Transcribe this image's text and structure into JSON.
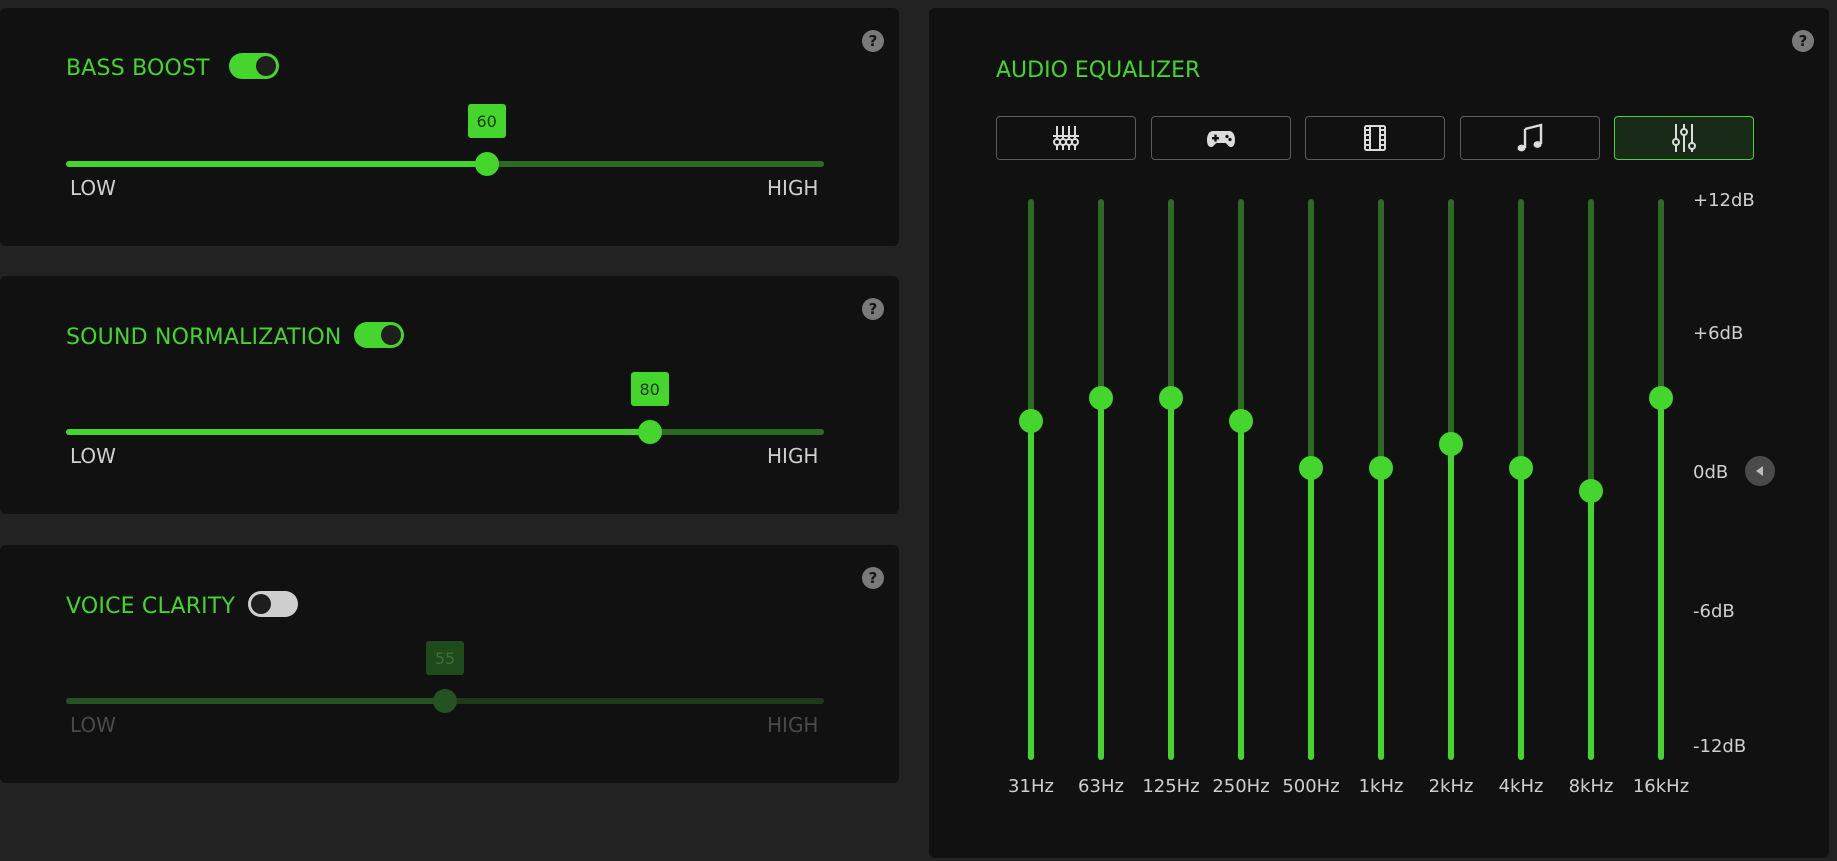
{
  "help_glyph": "?",
  "bass_boost": {
    "title": "BASS BOOST",
    "enabled": true,
    "value": 60,
    "value_label": "60",
    "fraction": 0.555,
    "low": "LOW",
    "high": "HIGH"
  },
  "sound_normalization": {
    "title": "SOUND NORMALIZATION",
    "enabled": true,
    "value": 80,
    "value_label": "80",
    "fraction": 0.77,
    "low": "LOW",
    "high": "HIGH"
  },
  "voice_clarity": {
    "title": "VOICE CLARITY",
    "enabled": false,
    "value": 55,
    "value_label": "55",
    "fraction": 0.5,
    "low": "LOW",
    "high": "HIGH"
  },
  "equalizer": {
    "title": "AUDIO EQUALIZER",
    "presets": [
      {
        "icon": "sliders-vertical-icon",
        "active": false
      },
      {
        "icon": "gamepad-icon",
        "active": false
      },
      {
        "icon": "film-icon",
        "active": false
      },
      {
        "icon": "music-note-icon",
        "active": false
      },
      {
        "icon": "custom-sliders-icon",
        "active": true
      }
    ],
    "scale": {
      "max": "+12dB",
      "plus6": "+6dB",
      "zero": "0dB",
      "minus6": "-6dB",
      "min": "-12dB"
    },
    "bands": [
      {
        "label": "31Hz",
        "db": 2.5
      },
      {
        "label": "63Hz",
        "db": 3.5
      },
      {
        "label": "125Hz",
        "db": 3.5
      },
      {
        "label": "250Hz",
        "db": 2.5
      },
      {
        "label": "500Hz",
        "db": 0.5
      },
      {
        "label": "1kHz",
        "db": 0.5
      },
      {
        "label": "2kHz",
        "db": 1.5
      },
      {
        "label": "4kHz",
        "db": 0.5
      },
      {
        "label": "8kHz",
        "db": -0.5
      },
      {
        "label": "16kHz",
        "db": 3.5
      }
    ]
  },
  "colors": {
    "accent": "#44d62c",
    "accent_dim": "#2d6b25",
    "panel": "#111111",
    "background": "#222222"
  }
}
